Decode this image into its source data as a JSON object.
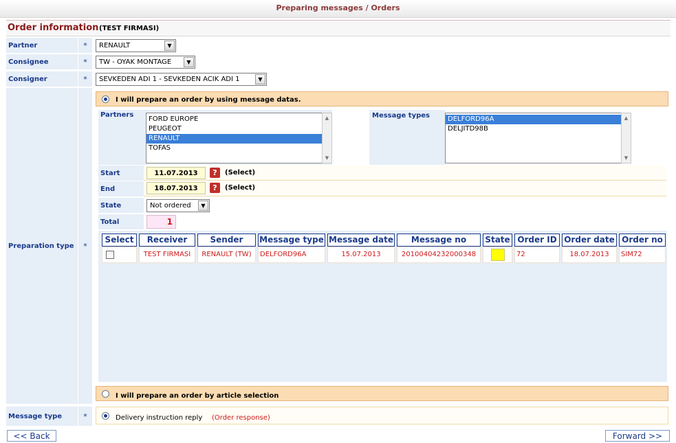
{
  "window": {
    "title": "Preparing messages / Orders"
  },
  "header": {
    "title": "Order information",
    "company": "(TEST FIRMASI)"
  },
  "fields": {
    "partner": {
      "label": "Partner",
      "required": "*",
      "value": "RENAULT"
    },
    "consignee": {
      "label": "Consignee",
      "required": "*",
      "value": "TW - OYAK MONTAGE"
    },
    "consigner": {
      "label": "Consigner",
      "required": "*",
      "value": "SEVKEDEN ADI 1 - SEVKEDEN ACIK ADI 1"
    },
    "preparation_type": {
      "label": "Preparation type",
      "required": "*"
    },
    "message_type": {
      "label": "Message type",
      "required": "*"
    }
  },
  "prep": {
    "option_message": "I will prepare an order by using message datas.",
    "option_article": "I will prepare an order by article selection",
    "partners_label": "Partners",
    "partners": [
      "FORD EUROPE",
      "PEUGEOT",
      "RENAULT",
      "TOFAS"
    ],
    "partners_selected": "RENAULT",
    "message_types_label": "Message types",
    "message_types": [
      "DELFORD96A",
      "DELJITD98B"
    ],
    "message_types_selected": "DELFORD96A",
    "start_label": "Start",
    "start_value": "11.07.2013",
    "end_label": "End",
    "end_value": "18.07.2013",
    "select_link": "(Select)",
    "state_label": "State",
    "state_value": "Not ordered",
    "total_label": "Total",
    "total_value": "1"
  },
  "grid": {
    "columns": [
      "Select",
      "Receiver",
      "Sender",
      "Message type",
      "Message date",
      "Message no",
      "State",
      "Order ID",
      "Order date",
      "Order no"
    ],
    "rows": [
      {
        "receiver": "TEST FIRMASI",
        "sender": "RENAULT (TW)",
        "message_type": "DELFORD96A",
        "message_date": "15.07.2013",
        "message_no": "20100404232000348",
        "state_color": "#ffff00",
        "order_id": "72",
        "order_date": "18.07.2013",
        "order_no": "SIM72"
      }
    ]
  },
  "message_type": {
    "option": "Delivery instruction reply",
    "option_note": "(Order response)"
  },
  "nav": {
    "back": "<< Back",
    "forward": "Forward >>"
  }
}
